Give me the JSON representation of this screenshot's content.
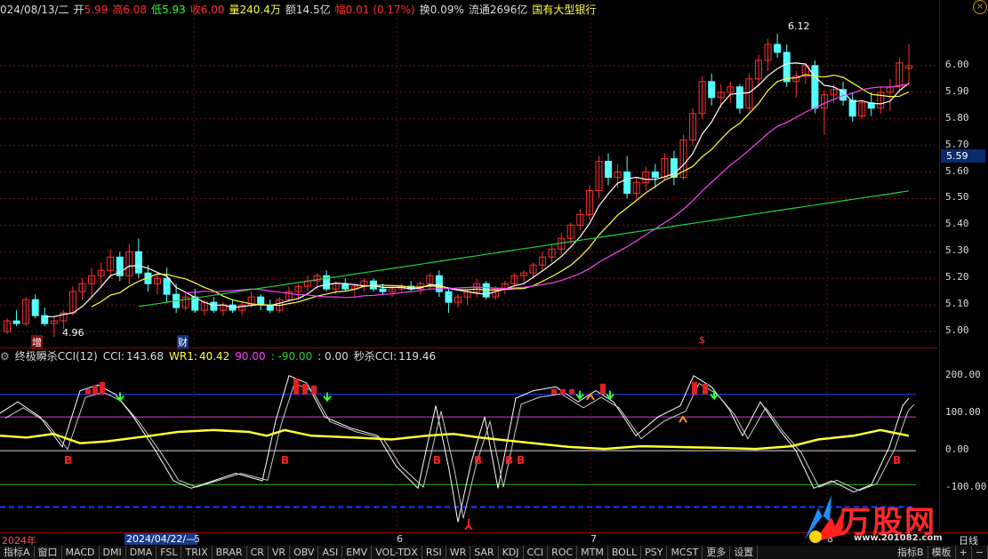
{
  "header": {
    "date_label": "024/08/13/二",
    "open_label": "开",
    "open": "5.99",
    "high_label": "高",
    "high": "6.08",
    "low_label": "低",
    "low": "5.93",
    "close_label": "收",
    "close": "6.00",
    "volume_label": "量",
    "volume": "240.4万",
    "amount_label": "额",
    "amount": "14.5亿",
    "change_label": "幅",
    "change": "0.01 (0.17%)",
    "turnover_label": "换",
    "turnover": "0.09%",
    "float_label": "流通",
    "float_cap": "2696亿",
    "sector": "国有大型银行"
  },
  "price_axis": {
    "ticks": [
      "6.00",
      "5.90",
      "5.80",
      "5.70",
      "5.60",
      "5.50",
      "5.40",
      "5.30",
      "5.20",
      "5.10",
      "5.00"
    ],
    "current_price": "5.59"
  },
  "annotations": {
    "high_label": "6.12",
    "low_label": "4.96",
    "event_zeng": "增",
    "event_cai": "财",
    "event_s": "$"
  },
  "indicator": {
    "name": "终极瞬杀CCI(12)",
    "cci_label": "CCI:",
    "cci": "143.68",
    "wr1_label": "WR1:",
    "wr1": "40.42",
    "v200": "90.00",
    "vneg": ": -90.00",
    "zero": ": 0.00",
    "miao_label": "秒杀CCI:",
    "miao": "119.46",
    "ticks": [
      "200.00",
      "100.00",
      "0.00",
      "-100.00"
    ],
    "buy_signal": "B"
  },
  "time_axis": {
    "year": "2024年",
    "cursor_date": "2024/04/22/—",
    "months": [
      "5",
      "6",
      "7",
      "8"
    ],
    "right_label": "日线"
  },
  "tabs": [
    "指标A",
    "窗口",
    "MACD",
    "DMI",
    "DMA",
    "FSL",
    "TRIX",
    "BRAR",
    "CR",
    "VR",
    "OBV",
    "ASI",
    "EMV",
    "VOL-TDX",
    "RSI",
    "WR",
    "SAR",
    "KDJ",
    "CCI",
    "ROC",
    "MTM",
    "BOLL",
    "PSY",
    "MCST",
    "更多",
    "设置"
  ],
  "right_tabs": [
    "指标B",
    "模板",
    "+",
    "−"
  ],
  "logo": {
    "text": "万股网",
    "url": "www.201082.com"
  },
  "colors": {
    "up": "#ff3030",
    "down": "#54ffff",
    "ma_white": "#ffffff",
    "ma_yellow": "#ffff40",
    "ma_magenta": "#ff40ff",
    "ma_green": "#20d040"
  },
  "candles": [
    [
      5.0,
      5.05,
      4.99,
      5.04
    ],
    [
      5.04,
      5.08,
      5.02,
      5.03
    ],
    [
      5.03,
      5.13,
      5.02,
      5.12
    ],
    [
      5.12,
      5.14,
      5.05,
      5.06
    ],
    [
      5.06,
      5.09,
      5.02,
      5.03
    ],
    [
      5.03,
      5.06,
      4.98,
      5.04
    ],
    [
      5.04,
      5.08,
      5.01,
      5.07
    ],
    [
      5.07,
      5.17,
      5.06,
      5.15
    ],
    [
      5.15,
      5.2,
      5.12,
      5.18
    ],
    [
      5.18,
      5.24,
      5.13,
      5.21
    ],
    [
      5.21,
      5.26,
      5.17,
      5.23
    ],
    [
      5.23,
      5.31,
      5.2,
      5.28
    ],
    [
      5.28,
      5.3,
      5.19,
      5.21
    ],
    [
      5.21,
      5.33,
      5.18,
      5.3
    ],
    [
      5.3,
      5.35,
      5.2,
      5.22
    ],
    [
      5.22,
      5.25,
      5.15,
      5.18
    ],
    [
      5.18,
      5.22,
      5.14,
      5.2
    ],
    [
      5.2,
      5.24,
      5.11,
      5.14
    ],
    [
      5.14,
      5.18,
      5.07,
      5.09
    ],
    [
      5.09,
      5.15,
      5.08,
      5.13
    ],
    [
      5.13,
      5.16,
      5.07,
      5.08
    ],
    [
      5.08,
      5.12,
      5.06,
      5.11
    ],
    [
      5.11,
      5.13,
      5.07,
      5.08
    ],
    [
      5.08,
      5.11,
      5.06,
      5.1
    ],
    [
      5.1,
      5.12,
      5.07,
      5.08
    ],
    [
      5.08,
      5.11,
      5.06,
      5.1
    ],
    [
      5.1,
      5.15,
      5.09,
      5.13
    ],
    [
      5.13,
      5.14,
      5.08,
      5.1
    ],
    [
      5.1,
      5.12,
      5.07,
      5.08
    ],
    [
      5.08,
      5.13,
      5.07,
      5.12
    ],
    [
      5.12,
      5.17,
      5.11,
      5.15
    ],
    [
      5.15,
      5.18,
      5.12,
      5.17
    ],
    [
      5.17,
      5.21,
      5.15,
      5.19
    ],
    [
      5.19,
      5.22,
      5.16,
      5.21
    ],
    [
      5.21,
      5.23,
      5.15,
      5.16
    ],
    [
      5.16,
      5.19,
      5.14,
      5.18
    ],
    [
      5.18,
      5.2,
      5.15,
      5.16
    ],
    [
      5.16,
      5.18,
      5.13,
      5.17
    ],
    [
      5.17,
      5.2,
      5.15,
      5.19
    ],
    [
      5.19,
      5.2,
      5.15,
      5.16
    ],
    [
      5.16,
      5.18,
      5.14,
      5.15
    ],
    [
      5.15,
      5.17,
      5.13,
      5.16
    ],
    [
      5.16,
      5.18,
      5.15,
      5.17
    ],
    [
      5.17,
      5.19,
      5.15,
      5.16
    ],
    [
      5.16,
      5.19,
      5.14,
      5.18
    ],
    [
      5.18,
      5.22,
      5.16,
      5.21
    ],
    [
      5.21,
      5.23,
      5.13,
      5.15
    ],
    [
      5.15,
      5.16,
      5.07,
      5.11
    ],
    [
      5.11,
      5.14,
      5.09,
      5.13
    ],
    [
      5.13,
      5.16,
      5.1,
      5.15
    ],
    [
      5.15,
      5.2,
      5.13,
      5.18
    ],
    [
      5.18,
      5.19,
      5.12,
      5.13
    ],
    [
      5.13,
      5.17,
      5.12,
      5.16
    ],
    [
      5.16,
      5.19,
      5.14,
      5.18
    ],
    [
      5.18,
      5.22,
      5.17,
      5.21
    ],
    [
      5.21,
      5.23,
      5.18,
      5.22
    ],
    [
      5.22,
      5.26,
      5.2,
      5.25
    ],
    [
      5.25,
      5.3,
      5.23,
      5.28
    ],
    [
      5.28,
      5.33,
      5.26,
      5.31
    ],
    [
      5.31,
      5.37,
      5.29,
      5.35
    ],
    [
      5.35,
      5.41,
      5.33,
      5.4
    ],
    [
      5.4,
      5.46,
      5.38,
      5.44
    ],
    [
      5.44,
      5.55,
      5.42,
      5.53
    ],
    [
      5.53,
      5.66,
      5.5,
      5.64
    ],
    [
      5.64,
      5.67,
      5.55,
      5.58
    ],
    [
      5.58,
      5.63,
      5.54,
      5.6
    ],
    [
      5.6,
      5.66,
      5.5,
      5.52
    ],
    [
      5.52,
      5.58,
      5.5,
      5.56
    ],
    [
      5.56,
      5.62,
      5.53,
      5.6
    ],
    [
      5.6,
      5.63,
      5.54,
      5.58
    ],
    [
      5.58,
      5.67,
      5.57,
      5.65
    ],
    [
      5.65,
      5.68,
      5.55,
      5.58
    ],
    [
      5.58,
      5.74,
      5.57,
      5.72
    ],
    [
      5.72,
      5.84,
      5.7,
      5.82
    ],
    [
      5.82,
      5.96,
      5.8,
      5.94
    ],
    [
      5.94,
      5.97,
      5.85,
      5.88
    ],
    [
      5.88,
      5.93,
      5.84,
      5.9
    ],
    [
      5.9,
      5.94,
      5.86,
      5.92
    ],
    [
      5.92,
      5.93,
      5.82,
      5.84
    ],
    [
      5.84,
      5.97,
      5.83,
      5.95
    ],
    [
      5.95,
      6.04,
      5.92,
      6.02
    ],
    [
      6.02,
      6.1,
      5.98,
      6.08
    ],
    [
      6.08,
      6.12,
      6.03,
      6.05
    ],
    [
      6.05,
      6.08,
      5.92,
      5.94
    ],
    [
      5.94,
      5.98,
      5.88,
      5.96
    ],
    [
      5.96,
      6.01,
      5.93,
      6.0
    ],
    [
      6.0,
      6.02,
      5.82,
      5.84
    ],
    [
      5.84,
      5.91,
      5.74,
      5.89
    ],
    [
      5.89,
      5.93,
      5.86,
      5.91
    ],
    [
      5.91,
      5.94,
      5.85,
      5.87
    ],
    [
      5.87,
      5.9,
      5.79,
      5.81
    ],
    [
      5.81,
      5.87,
      5.8,
      5.86
    ],
    [
      5.86,
      5.9,
      5.81,
      5.84
    ],
    [
      5.84,
      5.92,
      5.82,
      5.9
    ],
    [
      5.9,
      5.95,
      5.83,
      5.92
    ],
    [
      5.92,
      6.03,
      5.9,
      6.01
    ],
    [
      5.99,
      6.08,
      5.93,
      6.0
    ]
  ]
}
